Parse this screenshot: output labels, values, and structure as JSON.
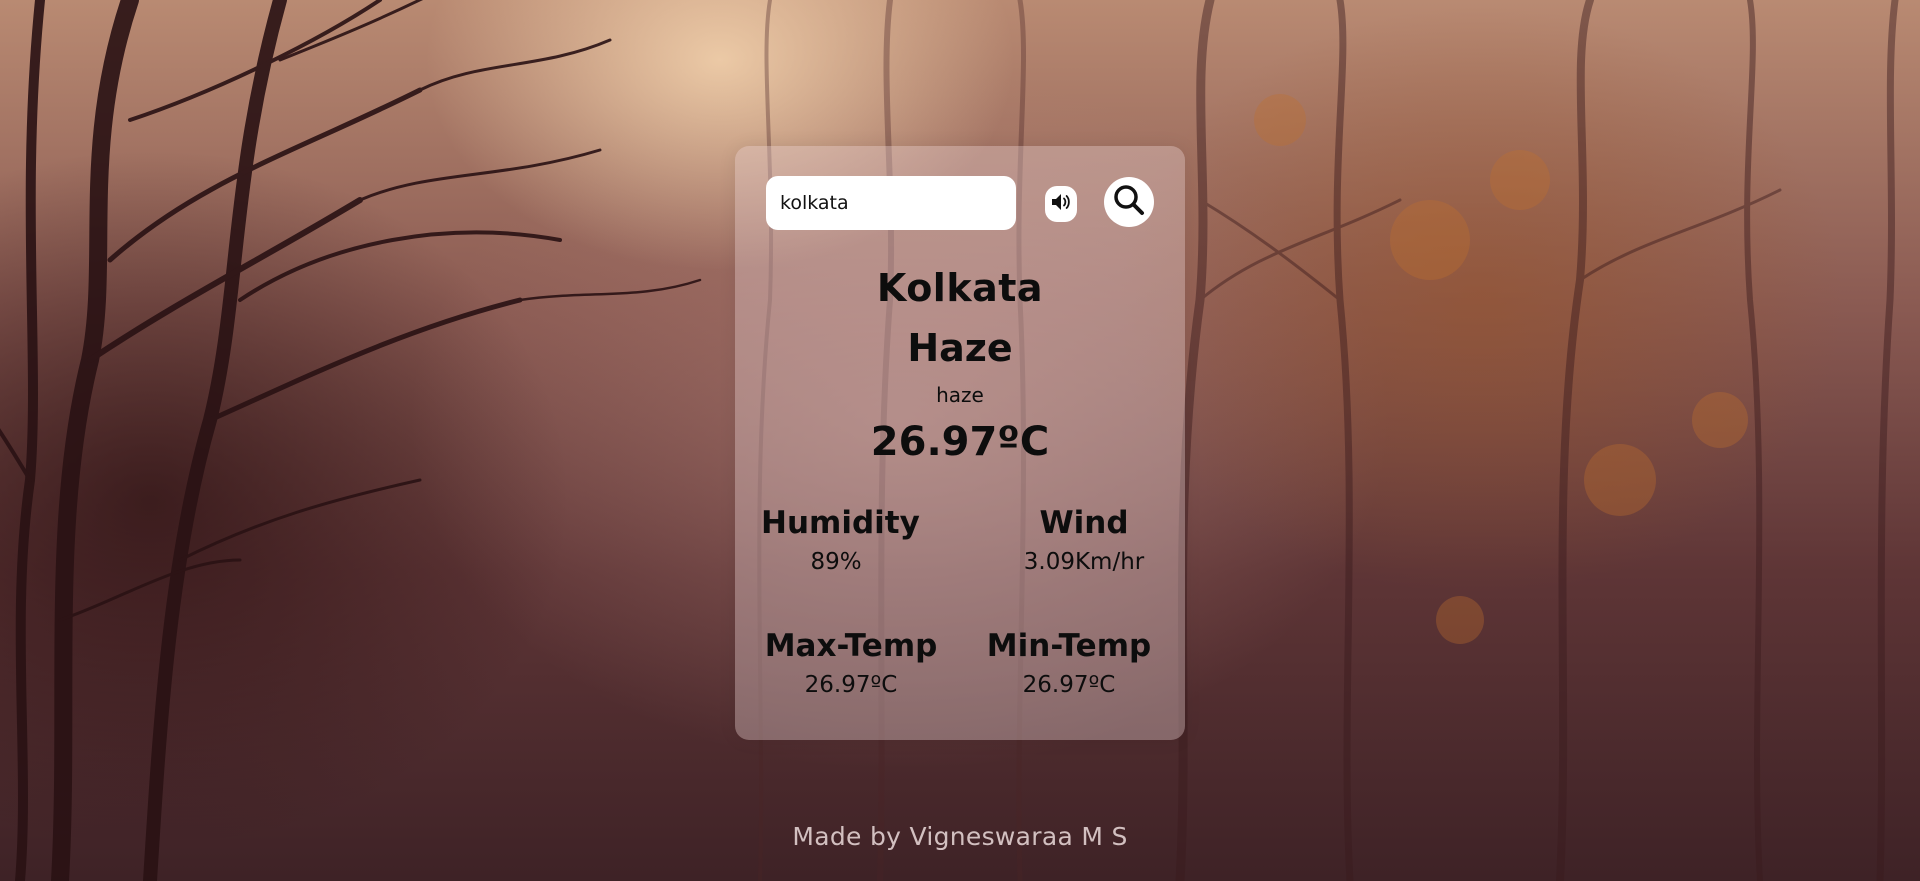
{
  "search": {
    "value": "kolkata"
  },
  "weather": {
    "city": "Kolkata",
    "condition": "Haze",
    "description": "haze",
    "temperature": "26.97ºC"
  },
  "stats": {
    "humidity": {
      "label": "Humidity",
      "value": "89%"
    },
    "wind": {
      "label": "Wind",
      "value": "3.09Km/hr"
    },
    "max_temp": {
      "label": "Max-Temp",
      "value": "26.97ºC"
    },
    "min_temp": {
      "label": "Min-Temp",
      "value": "26.97ºC"
    }
  },
  "footer": {
    "credit": "Made by Vigneswaraa M S"
  },
  "icons": {
    "speaker": "speaker-volume-icon",
    "search": "magnifying-glass-icon"
  },
  "colors": {
    "card_background": "#e4cdcd",
    "text": "#0d0d0d",
    "footer_text": "#decdcd"
  }
}
